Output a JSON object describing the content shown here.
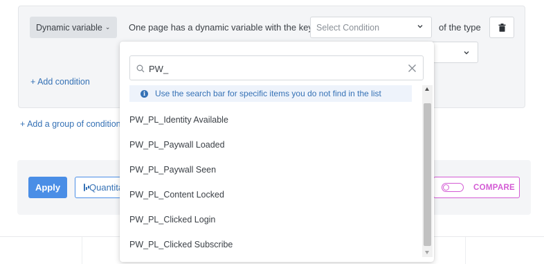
{
  "condition": {
    "variable_type_label": "Dynamic variable",
    "description": "One page has a dynamic variable with the key",
    "key_select_placeholder": "Select Condition",
    "type_text": "of the type",
    "add_condition_label": "+ Add condition",
    "add_group_label": "+ Add a group of conditions"
  },
  "actions": {
    "apply_label": "Apply",
    "quant_label": "Quantitative",
    "compare_label": "COMPARE",
    "compare_on": false
  },
  "dropdown": {
    "search_value": "PW_",
    "info_text": "Use the search bar for specific items you do not find in the list",
    "options": [
      "PW_PL_Identity Available",
      "PW_PL_Paywall Loaded",
      "PW_PL_Paywall Seen",
      "PW_PL_Content Locked",
      "PW_PL_Clicked Login",
      "PW_PL_Clicked Subscribe"
    ]
  },
  "colors": {
    "accent": "#4a8ee6",
    "link": "#3571b5",
    "compare": "#d35ad4"
  }
}
